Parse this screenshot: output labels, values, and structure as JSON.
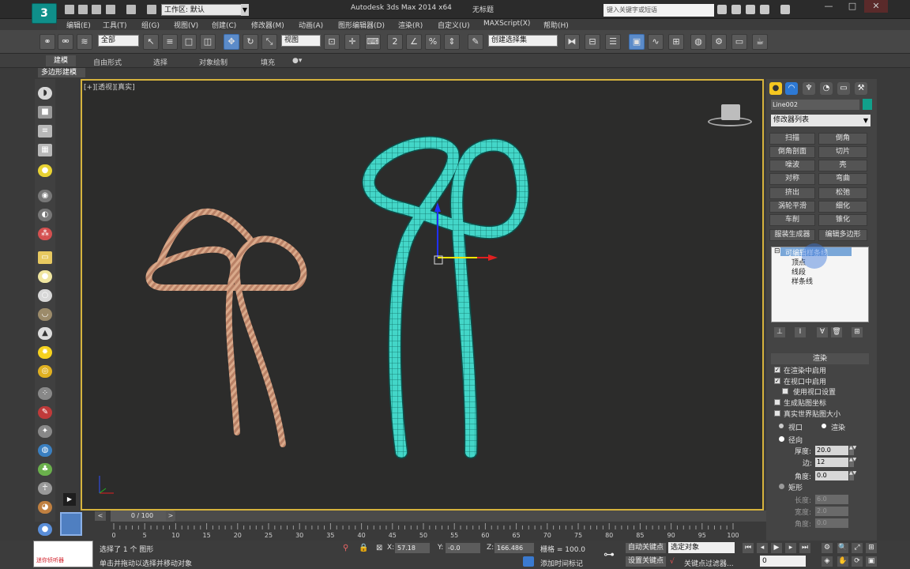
{
  "titlebar": {
    "workspace": "工作区: 默认",
    "app_title": "Autodesk 3ds Max  2014 x64",
    "file_name": "无标题",
    "search_placeholder": "键入关键字或短语",
    "win_controls": [
      "—",
      "□",
      "✕"
    ]
  },
  "menus": [
    "编辑(E)",
    "工具(T)",
    "组(G)",
    "视图(V)",
    "创建(C)",
    "修改器(M)",
    "动画(A)",
    "图形编辑器(D)",
    "渲染(R)",
    "自定义(U)",
    "MAXScript(X)",
    "帮助(H)"
  ],
  "toolbar": {
    "selection_filter": "全部",
    "coord_system": "视图",
    "named_selection": "创建选择集"
  },
  "ribbon": {
    "tabs": [
      "建模",
      "自由形式",
      "选择",
      "对象绘制",
      "填充"
    ],
    "active_tab": "建模",
    "sub_label": "多边形建模"
  },
  "viewport": {
    "label": "[+][透视][真实]"
  },
  "command_panel": {
    "object_name": "Line002",
    "object_color": "#11a08b",
    "modifier_list": "修改器列表",
    "modifier_buttons": [
      [
        "扫描",
        "倒角"
      ],
      [
        "倒角剖面",
        "切片"
      ],
      [
        "噪波",
        "壳"
      ],
      [
        "对称",
        "弯曲"
      ],
      [
        "挤出",
        "松弛"
      ],
      [
        "涡轮平滑",
        "细化"
      ],
      [
        "车削",
        "锥化"
      ],
      [
        "服装生成器",
        "编辑多边形"
      ]
    ],
    "stack": {
      "root": "可编辑样条线",
      "children": [
        "顶点",
        "线段",
        "样条线"
      ]
    },
    "rollout": {
      "title": "渲染",
      "enable_in_renderer": "在渲染中启用",
      "enable_in_viewport": "在视口中启用",
      "use_viewport_settings": "使用视口设置",
      "gen_mapping": "生成贴图坐标",
      "real_world_map": "真实世界贴图大小",
      "viewport_radio": "视口",
      "render_radio": "渲染",
      "radial": "径向",
      "thickness_label": "厚度:",
      "thickness": "20.0",
      "sides_label": "边:",
      "sides": "12",
      "angle_label": "角度:",
      "angle": "0.0",
      "rectangular": "矩形",
      "length_label": "长度:",
      "length": "6.0",
      "width_label": "宽度:",
      "width": "2.0",
      "angle2_label": "角度:",
      "angle2": "0.0"
    }
  },
  "timeline": {
    "frame": "0 / 100",
    "ticks": [
      "0",
      "5",
      "10",
      "15",
      "20",
      "25",
      "30",
      "35",
      "40",
      "45",
      "50",
      "55",
      "60",
      "65",
      "70",
      "75",
      "80",
      "85",
      "90",
      "95",
      "100"
    ]
  },
  "status": {
    "maxscript_text": "迷你侦听器",
    "selected": "选择了 1 个 图形",
    "prompt": "单击并拖动以选择并移动对象",
    "x_label": "X:",
    "x": "57.18",
    "y_label": "Y:",
    "y": "-0.0",
    "z_label": "Z:",
    "z": "166.486",
    "grid": "栅格 = 100.0",
    "add_time_tag": "添加时间标记",
    "auto_key": "自动关键点",
    "set_key": "设置关键点",
    "selected_obj": "选定对象",
    "key_filters": "关键点过滤器...",
    "current_frame": "0"
  }
}
